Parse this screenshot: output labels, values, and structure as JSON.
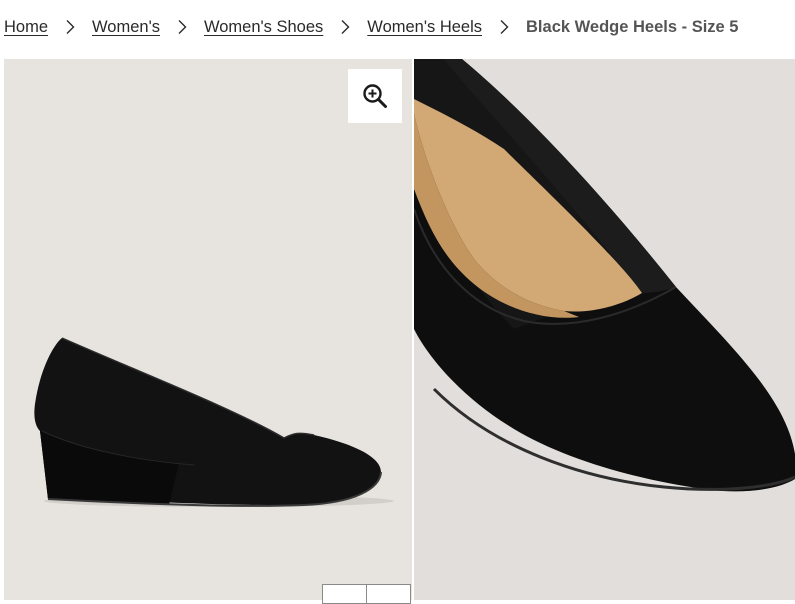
{
  "breadcrumb": {
    "items": [
      {
        "label": "Home"
      },
      {
        "label": "Women's"
      },
      {
        "label": "Women's Shoes"
      },
      {
        "label": "Women's Heels"
      }
    ],
    "current": "Black Wedge Heels - Size 5"
  },
  "icons": {
    "separator": "chevron-right-icon",
    "zoom": "zoom-in-icon"
  },
  "colors": {
    "text": "#2a2a2a",
    "current_text": "#555555",
    "image_background": "#e7e4e0",
    "shoe": "#0d0d0d",
    "lining": "#d2a874"
  }
}
